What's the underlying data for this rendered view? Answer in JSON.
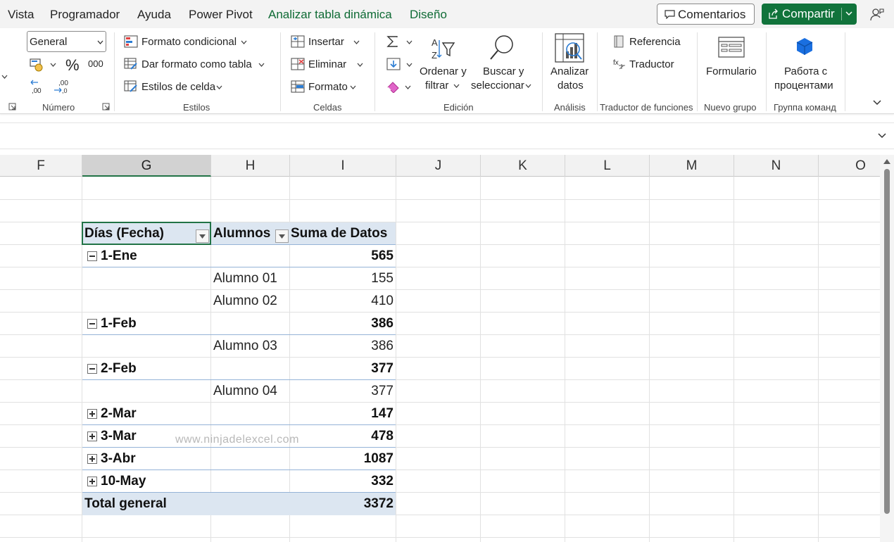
{
  "menu": {
    "items": [
      "Vista",
      "Programador",
      "Ayuda",
      "Power Pivot",
      "Analizar tabla dinámica",
      "Diseño"
    ],
    "comments_label": "Comentarios",
    "share_label": "Compartir"
  },
  "ribbon": {
    "number": {
      "format_value": "General",
      "percent": "%",
      "thousands": "000",
      "label": "Número"
    },
    "styles": {
      "conditional": "Formato condicional",
      "as_table": "Dar formato como tabla",
      "cell_styles": "Estilos de celda",
      "label": "Estilos"
    },
    "cells": {
      "insert": "Insertar",
      "delete": "Eliminar",
      "format": "Formato",
      "label": "Celdas"
    },
    "editing": {
      "sort_line1": "Ordenar y",
      "sort_line2": "filtrar",
      "find_line1": "Buscar y",
      "find_line2": "seleccionar",
      "label": "Edición"
    },
    "analysis": {
      "analyze_line1": "Analizar",
      "analyze_line2": "datos",
      "label": "Análisis"
    },
    "translator": {
      "reference": "Referencia",
      "translator": "Traductor",
      "label": "Traductor de funciones"
    },
    "new_group": {
      "form": "Formulario",
      "label": "Nuevo grupo"
    },
    "command_group": {
      "line1": "Работа с",
      "line2": "процентами",
      "label": "Группа команд"
    }
  },
  "columns": [
    "F",
    "G",
    "H",
    "I",
    "J",
    "K",
    "L",
    "M",
    "N",
    "O"
  ],
  "selected_column": "G",
  "pivot": {
    "headers": {
      "dias": "Días (Fecha)",
      "alumnos": "Alumnos",
      "suma": "Suma de Datos"
    },
    "rows": [
      {
        "kind": "group",
        "expanded": true,
        "label": "1-Ene",
        "value": "565"
      },
      {
        "kind": "item",
        "label": "Alumno 01",
        "value": "155"
      },
      {
        "kind": "item",
        "label": "Alumno 02",
        "value": "410"
      },
      {
        "kind": "group",
        "expanded": true,
        "label": "1-Feb",
        "value": "386"
      },
      {
        "kind": "item",
        "label": "Alumno 03",
        "value": "386"
      },
      {
        "kind": "group",
        "expanded": true,
        "label": "2-Feb",
        "value": "377"
      },
      {
        "kind": "item",
        "label": "Alumno 04",
        "value": "377"
      },
      {
        "kind": "group",
        "expanded": false,
        "label": "2-Mar",
        "value": "147"
      },
      {
        "kind": "group",
        "expanded": false,
        "label": "3-Mar",
        "value": "478"
      },
      {
        "kind": "group",
        "expanded": false,
        "label": "3-Abr",
        "value": "1087"
      },
      {
        "kind": "group",
        "expanded": false,
        "label": "10-May",
        "value": "332"
      }
    ],
    "total_label": "Total general",
    "total_value": "3372"
  },
  "watermark": "www.ninjadelexcel.com"
}
